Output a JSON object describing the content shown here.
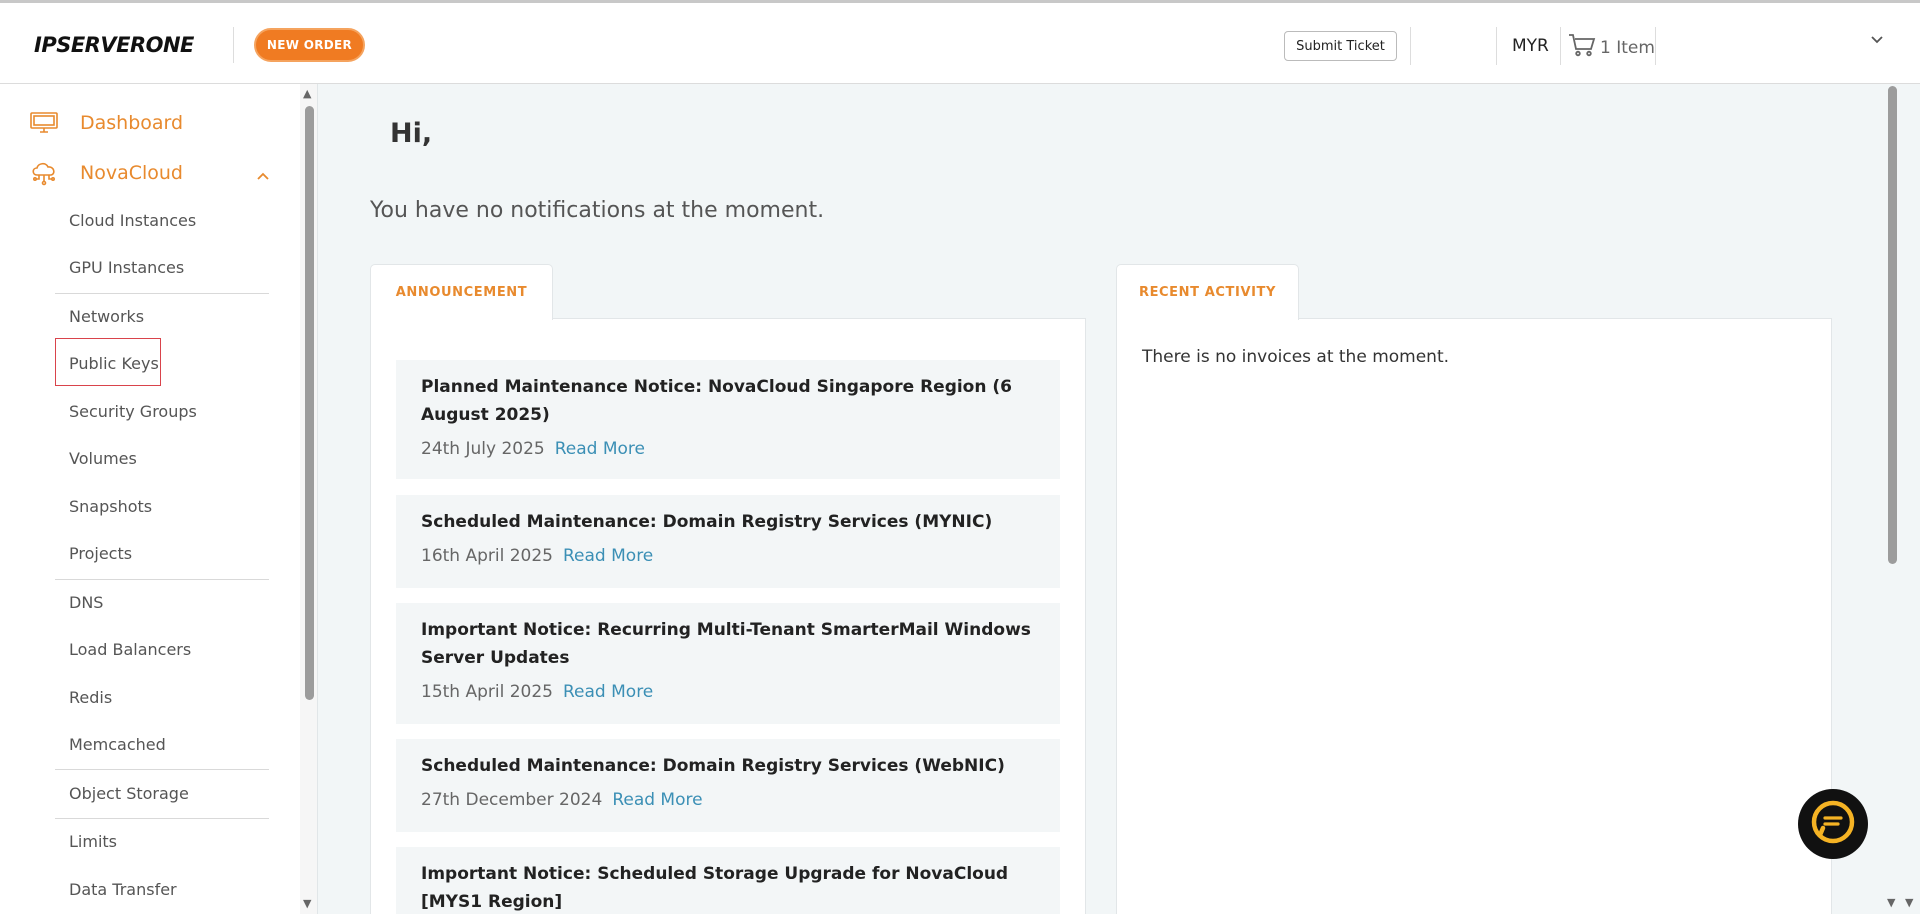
{
  "header": {
    "logo_text": "IPSERVERONE",
    "new_order_label": "NEW ORDER",
    "submit_ticket_label": "Submit Ticket",
    "currency": "MYR",
    "cart_label": "1 Item"
  },
  "sidebar": {
    "dashboard_label": "Dashboard",
    "novacloud_label": "NovaCloud",
    "items": [
      {
        "label": "Cloud Instances"
      },
      {
        "label": "GPU Instances"
      },
      {
        "label": "Networks"
      },
      {
        "label": "Public Keys"
      },
      {
        "label": "Security Groups"
      },
      {
        "label": "Volumes"
      },
      {
        "label": "Snapshots"
      },
      {
        "label": "Projects"
      },
      {
        "label": "DNS"
      },
      {
        "label": "Load Balancers"
      },
      {
        "label": "Redis"
      },
      {
        "label": "Memcached"
      },
      {
        "label": "Object Storage"
      },
      {
        "label": "Limits"
      },
      {
        "label": "Data Transfer"
      }
    ]
  },
  "main": {
    "greeting": "Hi,",
    "notification_text": "You have no notifications at the moment.",
    "announcement_tab": "ANNOUNCEMENT",
    "activity_tab": "RECENT ACTIVITY",
    "no_invoices_text": "There is no invoices at the moment.",
    "read_more_label": "Read More",
    "announcements": [
      {
        "title": "Planned Maintenance Notice: NovaCloud Singapore Region (6 August 2025)",
        "date": "24th July 2025"
      },
      {
        "title": "Scheduled Maintenance: Domain Registry Services (MYNIC)",
        "date": "16th April 2025"
      },
      {
        "title": "Important Notice: Recurring Multi-Tenant SmarterMail Windows Server Updates",
        "date": "15th April 2025"
      },
      {
        "title": "Scheduled Maintenance: Domain Registry Services (WebNIC)",
        "date": "27th December 2024"
      },
      {
        "title": "Important Notice: Scheduled Storage Upgrade for NovaCloud [MYS1 Region]",
        "date": ""
      }
    ]
  },
  "colors": {
    "accent": "#f07b22",
    "link": "#3b8fb5",
    "highlight_border": "#d9434b"
  }
}
